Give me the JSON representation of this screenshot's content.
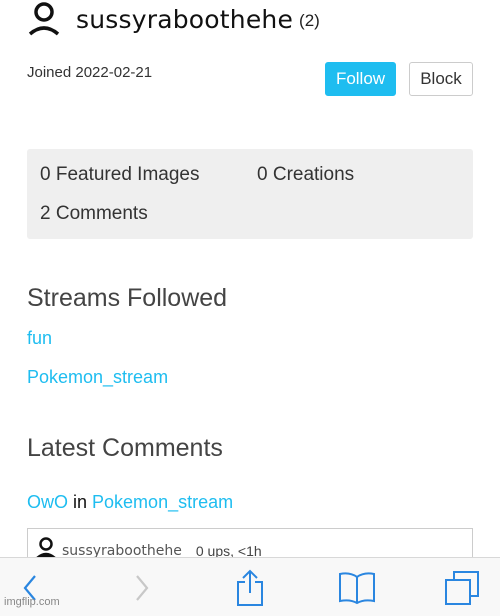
{
  "profile": {
    "username": "sussyraboothehe",
    "count": "(2)",
    "joined": "Joined 2022-02-21",
    "avatar_icon": "user-icon"
  },
  "actions": {
    "follow_label": "Follow",
    "block_label": "Block"
  },
  "stats": {
    "featured_images": "0 Featured Images",
    "creations": "0 Creations",
    "comments": "2 Comments"
  },
  "streams_followed": {
    "title": "Streams Followed",
    "items": [
      {
        "label": "fun"
      },
      {
        "label": "Pokemon_stream"
      }
    ]
  },
  "latest_comments": {
    "title": "Latest Comments",
    "items": [
      {
        "title": "OwO",
        "connector": " in ",
        "stream": "Pokemon_stream",
        "author": "sussyraboothehe",
        "meta": "0 ups, <1h"
      }
    ]
  },
  "browser_toolbar": {
    "icons": [
      "back-icon",
      "forward-icon",
      "share-icon",
      "bookmarks-icon",
      "tabs-icon"
    ]
  },
  "watermark": "imgflip.com",
  "colors": {
    "accent": "#1ebdf0",
    "stats_bg": "#efefef",
    "toolbar_icon": "#2a86e0",
    "toolbar_disabled": "#c8c8c8"
  }
}
